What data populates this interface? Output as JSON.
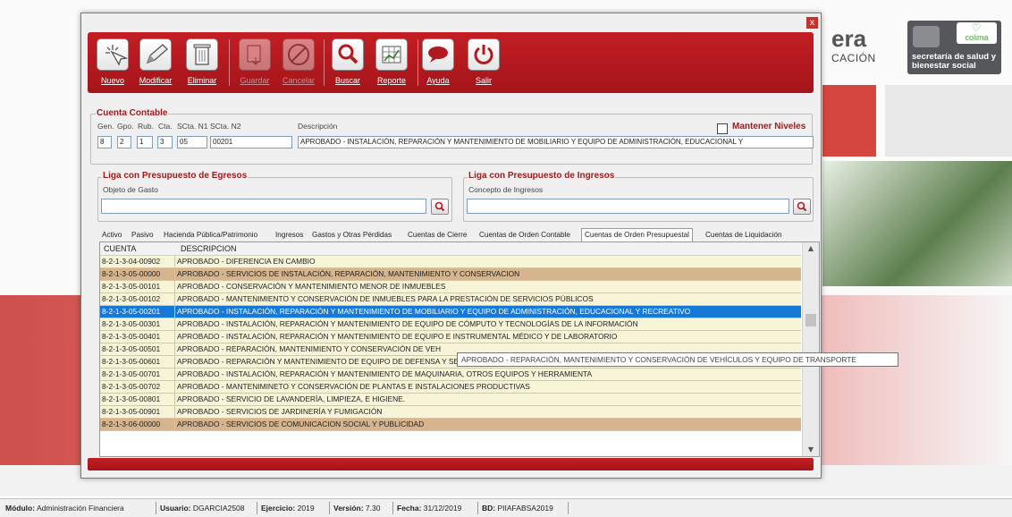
{
  "background": {
    "title": "era",
    "subtitle": "CACIÓN",
    "logo": {
      "brand": "colima",
      "text": "secretaría de salud y bienestar social"
    }
  },
  "window": {
    "close_glyph": "x"
  },
  "toolbar": {
    "buttons": [
      {
        "label": "Nuevo",
        "icon": "new-cursor-icon",
        "enabled": true
      },
      {
        "label": "Modificar",
        "icon": "pencil-icon",
        "enabled": true
      },
      {
        "label": "Eliminar",
        "icon": "trash-icon",
        "enabled": true
      },
      {
        "label": "Guardar",
        "icon": "save-icon",
        "enabled": false
      },
      {
        "label": "Cancelar",
        "icon": "cancel-icon",
        "enabled": false
      },
      {
        "label": "Buscar",
        "icon": "search-icon",
        "enabled": true
      },
      {
        "label": "Reporte",
        "icon": "report-icon",
        "enabled": true
      },
      {
        "label": "Ayuda",
        "icon": "help-bubble-icon",
        "enabled": true
      },
      {
        "label": "Salir",
        "icon": "power-icon",
        "enabled": true
      }
    ]
  },
  "cuenta": {
    "group_title": "Cuenta Contable",
    "headers": {
      "gen": "Gen.",
      "gpo": "Gpo.",
      "rub": "Rub.",
      "cta": "Cta.",
      "scta1": "SCta. N1",
      "scta2": "SCta. N2",
      "desc": "Descripción"
    },
    "values": {
      "gen": "8",
      "gpo": "2",
      "rub": "1",
      "cta": "3",
      "scta1": "05",
      "scta2": "00201",
      "desc": "APROBADO - INSTALACIÓN, REPARACIÓN Y MANTENIMIENTO DE MOBILIARIO Y EQUIPO DE ADMINISTRACIÓN, EDUCACIONAL Y"
    },
    "mantener_label": "Mantener Niveles"
  },
  "egresos": {
    "group_title": "Liga con Presupuesto de Egresos",
    "field_label": "Objeto de Gasto",
    "value": ""
  },
  "ingresos": {
    "group_title": "Liga con Presupuesto  de Ingresos",
    "field_label": "Concepto de Ingresos",
    "value": ""
  },
  "tabs": [
    {
      "label": "Activo",
      "active": false
    },
    {
      "label": "Pasivo",
      "active": false
    },
    {
      "label": "Hacienda Pública/Patrimonio",
      "active": false
    },
    {
      "label": "Ingresos",
      "active": false
    },
    {
      "label": "Gastos y Otras Pérdidas",
      "active": false
    },
    {
      "label": "Cuentas de Cierre",
      "active": false
    },
    {
      "label": "Cuentas de Orden Contable",
      "active": false
    },
    {
      "label": "Cuentas de Orden Presupuestal",
      "active": true
    },
    {
      "label": "Cuentas de Liquidación",
      "active": false
    }
  ],
  "grid": {
    "columns": [
      "CUENTA",
      "DESCRIPCION"
    ],
    "rows": [
      {
        "cuenta": "8-2-1-3-04-00902",
        "desc": "APROBADO - DIFERENCIA EN CAMBIO",
        "style": "light"
      },
      {
        "cuenta": "8-2-1-3-05-00000",
        "desc": "APROBADO - SERVICIOS DE INSTALACIÓN, REPARACIÓN, MANTENIMIENTO Y CONSERVACION",
        "style": "brown"
      },
      {
        "cuenta": "8-2-1-3-05-00101",
        "desc": "APROBADO - CONSERVACIÓN Y MANTENIMIENTO MENOR DE INMUEBLES",
        "style": "light"
      },
      {
        "cuenta": "8-2-1-3-05-00102",
        "desc": "APROBADO - MANTENIMIENTO Y CONSERVACIÓN DE INMUEBLES PARA LA PRESTACIÓN DE SERVICIOS PÚBLICOS",
        "style": "light"
      },
      {
        "cuenta": "8-2-1-3-05-00201",
        "desc": "APROBADO - INSTALACIÓN, REPARACIÓN Y MANTENIMIENTO DE MOBILIARIO Y EQUIPO DE ADMINISTRACIÓN, EDUCACIONAL Y RECREATIVO",
        "style": "sel"
      },
      {
        "cuenta": "8-2-1-3-05-00301",
        "desc": "APROBADO - INSTALACIÓN, REPARACIÓN Y MANTENIMIENTO DE EQUIPO DE CÓMPUTO Y TECNOLOGÍAS DE LA INFORMACIÓN",
        "style": "light"
      },
      {
        "cuenta": "8-2-1-3-05-00401",
        "desc": "APROBADO - INSTALACIÓN, REPARACIÓN Y MANTENIMIENTO DE EQUIPO E INSTRUMENTAL MÉDICO Y DE LABORATORIO",
        "style": "light"
      },
      {
        "cuenta": "8-2-1-3-05-00501",
        "desc": "APROBADO - REPARACIÓN, MANTENIMIENTO Y CONSERVACIÓN DE VEH",
        "style": "light"
      },
      {
        "cuenta": "8-2-1-3-05-00601",
        "desc": "APROBADO - REPARACIÓN Y MANTENIMIENTO DE EQUIPO DE DEFENSA Y SEGURIDAD",
        "style": "light"
      },
      {
        "cuenta": "8-2-1-3-05-00701",
        "desc": "APROBADO - INSTALACIÓN, REPARACIÓN Y MANTENIMIENTO DE MAQUINARIA, OTROS EQUIPOS Y HERRAMIENTA",
        "style": "light"
      },
      {
        "cuenta": "8-2-1-3-05-00702",
        "desc": "APROBADO - MANTENIMINETO Y CONSERVACIÓN DE PLANTAS E INSTALACIONES PRODUCTIVAS",
        "style": "light"
      },
      {
        "cuenta": "8-2-1-3-05-00801",
        "desc": "APROBADO - SERVICIO DE LAVANDERÍA, LIMPIEZA, E HIGIENE.",
        "style": "light"
      },
      {
        "cuenta": "8-2-1-3-05-00901",
        "desc": "APROBADO - SERVICIOS DE JARDINERÍA Y FUMIGACIÓN",
        "style": "light"
      },
      {
        "cuenta": "8-2-1-3-06-00000",
        "desc": "APROBADO - SERVICIOS DE COMUNICACION SOCIAL Y PUBLICIDAD",
        "style": "brown"
      }
    ],
    "tooltip": "APROBADO - REPARACIÓN, MANTENIMIENTO Y CONSERVACIÓN DE VEHÍCULOS Y EQUIPO DE TRANSPORTE"
  },
  "status": {
    "modulo_label": "Módulo:",
    "modulo": "Administración Financiera",
    "usuario_label": "Usuario:",
    "usuario": "DGARCIA2508",
    "ejercicio_label": "Ejercicio:",
    "ejercicio": "2019",
    "version_label": "Versión:",
    "version": "7.30",
    "fecha_label": "Fecha:",
    "fecha": "31/12/2019",
    "bd_label": "BD:",
    "bd": "PIIAFABSA2019"
  },
  "colors": {
    "accent": "#b21a1f",
    "selection": "#1679d9",
    "row_light": "#f8f4d8",
    "row_brown": "#d6b48e"
  }
}
